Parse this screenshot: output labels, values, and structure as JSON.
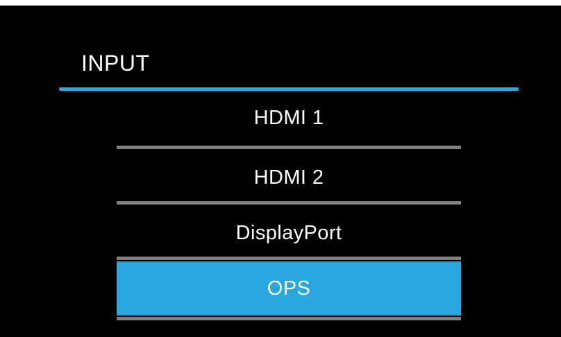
{
  "menu": {
    "title": "INPUT",
    "accent_color": "#29a8e0",
    "divider_color": "#7f7f7f",
    "items": [
      {
        "label": "HDMI 1",
        "selected": false
      },
      {
        "label": "HDMI 2",
        "selected": false
      },
      {
        "label": "DisplayPort",
        "selected": false
      },
      {
        "label": "OPS",
        "selected": true
      }
    ]
  }
}
